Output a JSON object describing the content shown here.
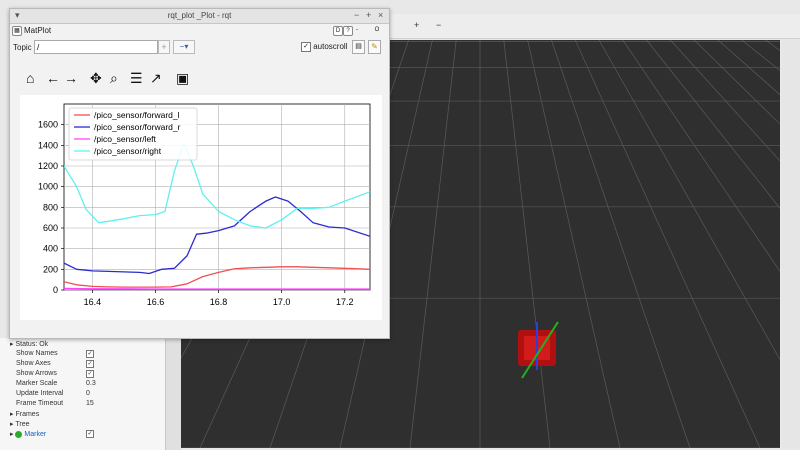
{
  "window": {
    "title": "rqt_plot _Plot - rqt",
    "dock_title": "MatPlot",
    "dock_buttons": [
      "D",
      "?",
      "-",
      "O"
    ]
  },
  "topic": {
    "label": "Topic",
    "value": "/",
    "add_icon": "plus-icon",
    "remove_icon": "minus-dropdown-icon"
  },
  "autoscroll": {
    "label": "autoscroll",
    "checked": true
  },
  "nav_toolbar": [
    {
      "name": "home-icon",
      "glyph": "⌂"
    },
    {
      "name": "back-arrow-icon",
      "glyph": "←"
    },
    {
      "name": "forward-arrow-icon",
      "glyph": "→"
    },
    {
      "name": "pan-icon",
      "glyph": "✥"
    },
    {
      "name": "zoom-icon",
      "glyph": "⌕"
    },
    {
      "name": "configure-subplots-icon",
      "glyph": "☰"
    },
    {
      "name": "edit-axis-icon",
      "glyph": "↗"
    },
    {
      "name": "save-icon",
      "glyph": "▣"
    }
  ],
  "chart_data": {
    "type": "line",
    "xlim": [
      16.31,
      17.28
    ],
    "ylim": [
      0,
      1800
    ],
    "xticks": [
      16.4,
      16.6,
      16.8,
      17.0,
      17.2
    ],
    "yticks": [
      0,
      200,
      400,
      600,
      800,
      1000,
      1200,
      1400,
      1600
    ],
    "grid": true,
    "legend_position": "top-left",
    "series": [
      {
        "name": "/pico_sensor/forward_l",
        "color": "#f05050",
        "x": [
          16.31,
          16.35,
          16.4,
          16.45,
          16.5,
          16.55,
          16.6,
          16.65,
          16.7,
          16.75,
          16.8,
          16.85,
          16.9,
          16.95,
          17.0,
          17.05,
          17.1,
          17.15,
          17.2,
          17.28
        ],
        "y": [
          80,
          50,
          35,
          30,
          28,
          28,
          28,
          30,
          60,
          130,
          170,
          205,
          215,
          220,
          225,
          225,
          220,
          215,
          210,
          200
        ]
      },
      {
        "name": "/pico_sensor/forward_r",
        "color": "#2b2bd0",
        "x": [
          16.31,
          16.35,
          16.4,
          16.45,
          16.5,
          16.55,
          16.58,
          16.62,
          16.66,
          16.7,
          16.73,
          16.76,
          16.8,
          16.85,
          16.9,
          16.95,
          16.98,
          17.02,
          17.06,
          17.1,
          17.15,
          17.2,
          17.28
        ],
        "y": [
          260,
          200,
          185,
          180,
          175,
          170,
          160,
          200,
          210,
          330,
          540,
          550,
          575,
          620,
          760,
          860,
          900,
          860,
          760,
          650,
          610,
          600,
          520
        ]
      },
      {
        "name": "/pico_sensor/left",
        "color": "#ff44ff",
        "x": [
          16.31,
          16.4,
          16.5,
          16.6,
          16.7,
          16.8,
          16.9,
          17.0,
          17.1,
          17.2,
          17.28
        ],
        "y": [
          15,
          12,
          12,
          10,
          10,
          10,
          10,
          10,
          10,
          10,
          10
        ]
      },
      {
        "name": "/pico_sensor/right",
        "color": "#5ff0f0",
        "x": [
          16.31,
          16.35,
          16.38,
          16.42,
          16.46,
          16.5,
          16.55,
          16.6,
          16.63,
          16.66,
          16.69,
          16.72,
          16.75,
          16.8,
          16.85,
          16.9,
          16.95,
          17.0,
          17.05,
          17.1,
          17.15,
          17.2,
          17.28
        ],
        "y": [
          1200,
          1000,
          780,
          650,
          670,
          690,
          720,
          730,
          760,
          1150,
          1420,
          1200,
          930,
          760,
          680,
          620,
          600,
          680,
          790,
          790,
          800,
          860,
          950
        ]
      }
    ]
  },
  "rviz": {
    "toolbar_items": [
      "+",
      "−"
    ],
    "display_rows": [
      {
        "label": "Status: Ok",
        "value": "",
        "kind": "status"
      },
      {
        "label": "Show Names",
        "value": "✓",
        "kind": "check"
      },
      {
        "label": "Show Axes",
        "value": "✓",
        "kind": "check"
      },
      {
        "label": "Show Arrows",
        "value": "✓",
        "kind": "check"
      },
      {
        "label": "Marker Scale",
        "value": "0.3",
        "kind": "text"
      },
      {
        "label": "Update Interval",
        "value": "0",
        "kind": "text"
      },
      {
        "label": "Frame Timeout",
        "value": "15",
        "kind": "text"
      },
      {
        "label": "Frames",
        "value": "",
        "kind": "group"
      },
      {
        "label": "Tree",
        "value": "",
        "kind": "group"
      },
      {
        "label": "Marker",
        "value": "✓",
        "kind": "marker"
      }
    ]
  }
}
